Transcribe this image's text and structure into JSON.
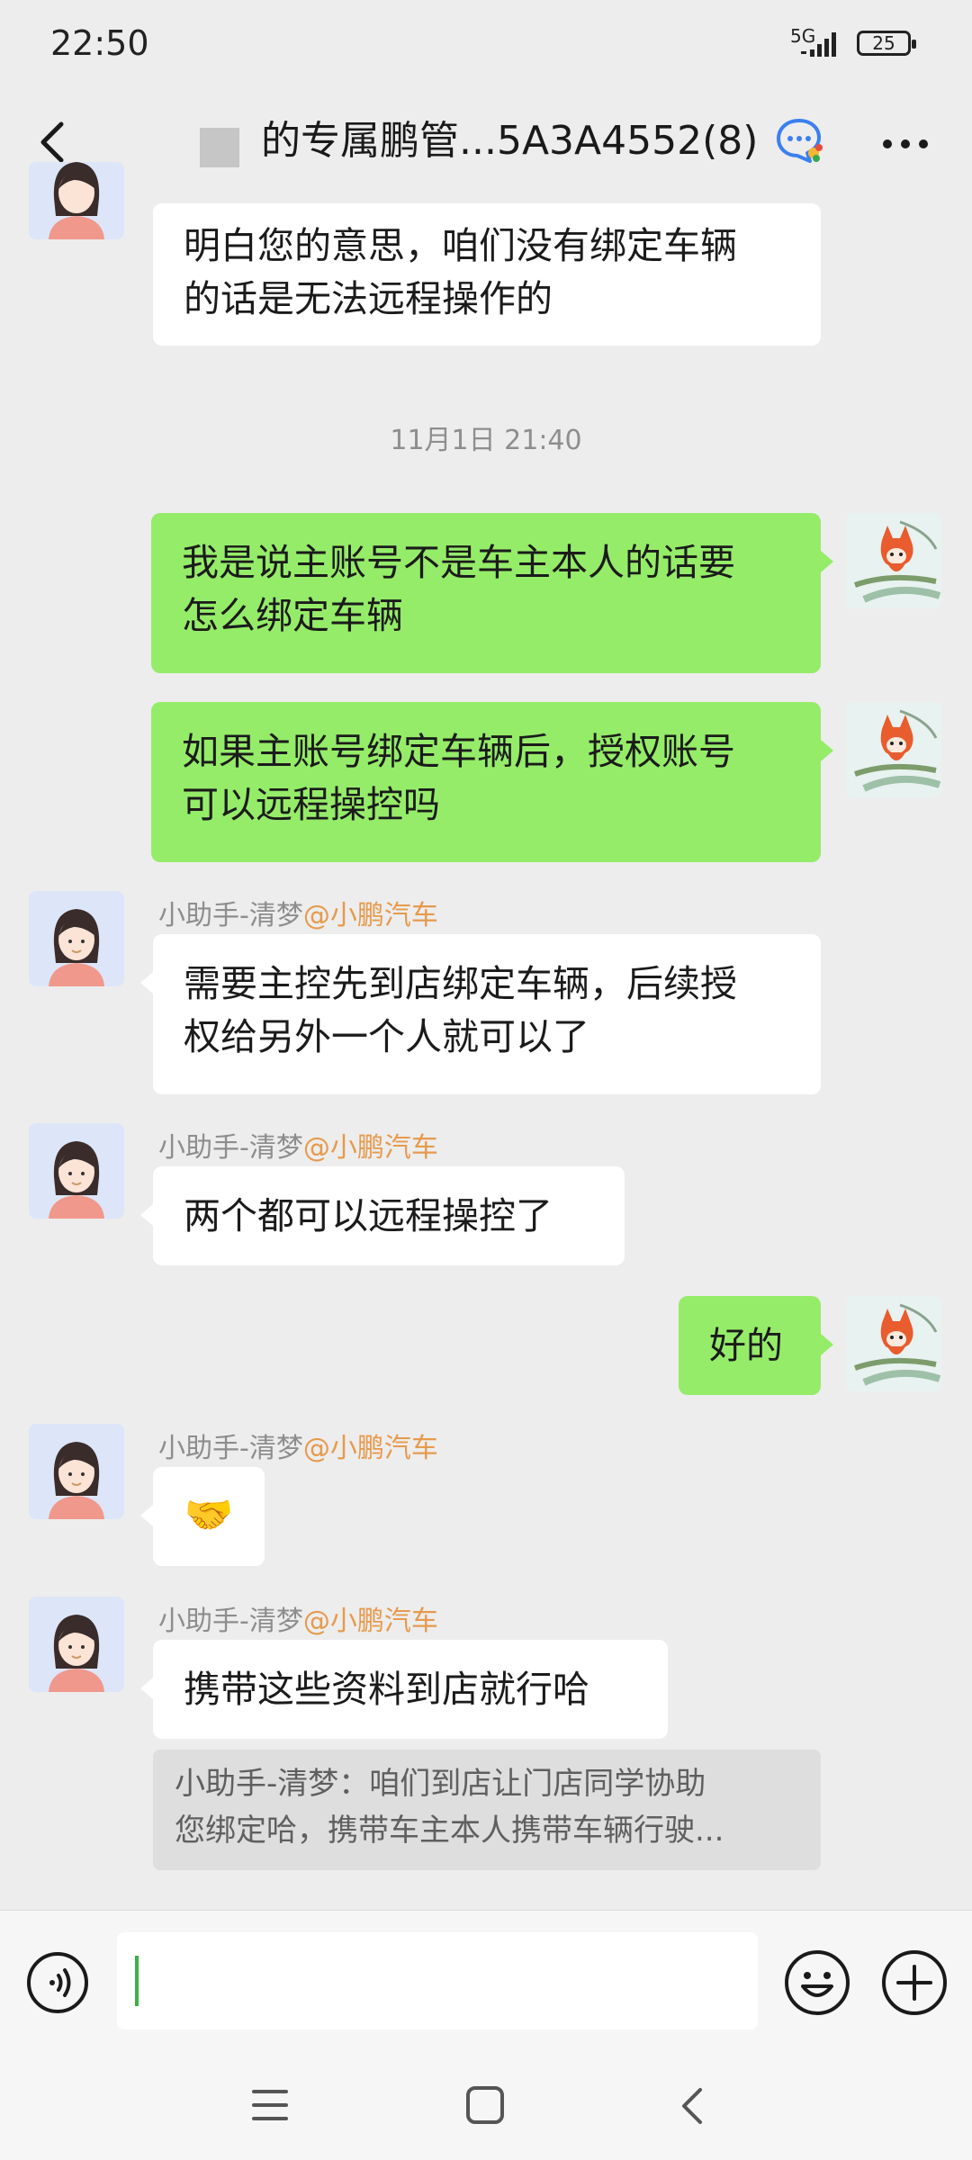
{
  "status_bar": {
    "time": "22:50",
    "network": "5G",
    "battery": "25"
  },
  "header": {
    "title": "的专属鹏管...5A3A4552(8)"
  },
  "messages": [
    {
      "text_lines": [
        "明白您的意思，咱们没有绑定车辆",
        "的话是无法远程操作的"
      ]
    },
    {
      "timestamp": "11月1日 21:40"
    },
    {
      "text_lines": [
        "我是说主账号不是车主本人的话要",
        "怎么绑定车辆"
      ]
    },
    {
      "text_lines": [
        "如果主账号绑定车辆后，授权账号",
        "可以远程操控吗"
      ]
    },
    {
      "sender": "小助手-清梦",
      "mention": "@小鹏汽车",
      "text_lines": [
        "需要主控先到店绑定车辆，后续授",
        "权给另外一个人就可以了"
      ]
    },
    {
      "sender": "小助手-清梦",
      "mention": "@小鹏汽车",
      "text_lines": [
        "两个都可以远程操控了"
      ]
    },
    {
      "text_lines": [
        "好的"
      ]
    },
    {
      "sender": "小助手-清梦",
      "mention": "@小鹏汽车",
      "emoji": "🤝"
    },
    {
      "sender": "小助手-清梦",
      "mention": "@小鹏汽车",
      "text_lines": [
        "携带这些资料到店就行哈"
      ],
      "quote_lines": [
        "小助手-清梦：咱们到店让门店同学协助",
        "您绑定哈，携带车主本人携带车辆行驶..."
      ]
    }
  ],
  "colors": {
    "background": "#ededed",
    "outgoing_bubble": "#95ec69",
    "incoming_bubble": "#ffffff",
    "mention": "#e69a4d",
    "cursor": "#3cb045"
  },
  "icons": [
    "back-arrow-icon",
    "chat-bubble-icon",
    "more-dots-icon",
    "voice-icon",
    "emoji-icon",
    "plus-icon",
    "menu-icon",
    "home-icon",
    "back-icon"
  ]
}
